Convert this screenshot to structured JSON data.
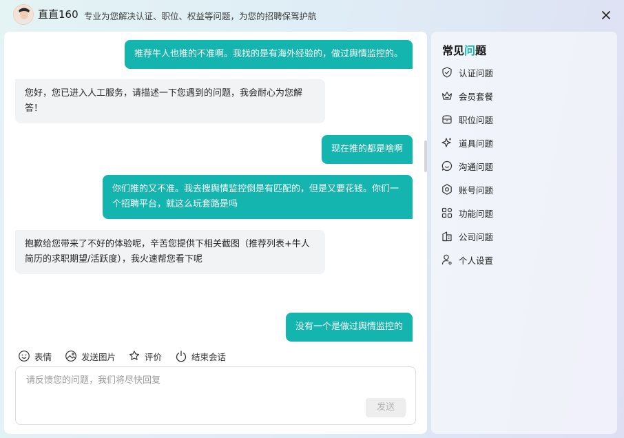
{
  "header": {
    "app_title": "直直160",
    "subtitle": "专业为您解决认证、职位、权益等问题，为您的招聘保驾护航",
    "icons": {
      "avatar": "user-avatar",
      "close": "close-icon"
    }
  },
  "chat": {
    "messages": [
      {
        "direction": "outgoing",
        "text": "推荐牛人也推的不准啊。我找的是有海外经验的，做过舆情监控的。"
      },
      {
        "direction": "incoming",
        "text": "您好，您已进入人工服务，请描述一下您遇到的问题，我会耐心为您解答！"
      },
      {
        "direction": "outgoing",
        "text": "现在推的都是啥啊"
      },
      {
        "direction": "outgoing",
        "text": "你们推的又不准。我去搜舆情监控倒是有匹配的，但是又要花钱。你们一个招聘平台，就这么玩套路是吗"
      },
      {
        "direction": "incoming",
        "text": "抱歉给您带来了不好的体验呢，辛苦您提供下相关截图（推荐列表+牛人简历的求职期望/活跃度），我火速帮您看下呢"
      },
      {
        "direction": "outgoing",
        "text": "没有一个是做过舆情监控的"
      }
    ],
    "toolbar": [
      {
        "label": "表情",
        "icon": "smiley-icon"
      },
      {
        "label": "发送图片",
        "icon": "image-icon"
      },
      {
        "label": "评价",
        "icon": "rate-icon"
      },
      {
        "label": "结束会话",
        "icon": "power-icon"
      }
    ],
    "input": {
      "placeholder": "请反馈您的问题，我们将尽快回复",
      "value": ""
    },
    "send_label": "发送"
  },
  "faq": {
    "title_prefix": "常见",
    "title_accent": "问",
    "title_suffix": "题",
    "items": [
      {
        "label": "认证问题",
        "icon": "shield-check-icon"
      },
      {
        "label": "会员套餐",
        "icon": "crown-icon"
      },
      {
        "label": "职位问题",
        "icon": "briefcase-icon"
      },
      {
        "label": "道具问题",
        "icon": "sparkle-icon"
      },
      {
        "label": "沟通问题",
        "icon": "chat-bubble-icon"
      },
      {
        "label": "账号问题",
        "icon": "account-settings-icon"
      },
      {
        "label": "功能问题",
        "icon": "grid-apps-icon"
      },
      {
        "label": "公司问题",
        "icon": "building-icon"
      },
      {
        "label": "个人设置",
        "icon": "person-gear-icon"
      }
    ]
  },
  "colors": {
    "accent": "#14b5ae",
    "incoming_bubble": "#f2f3f5"
  }
}
